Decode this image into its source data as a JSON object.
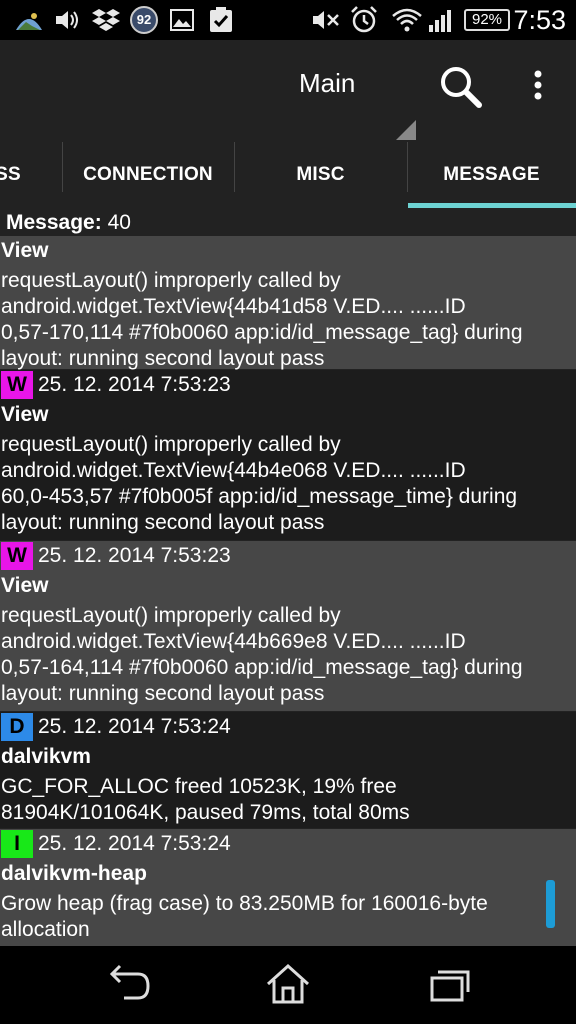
{
  "status_bar": {
    "time": "7:53",
    "battery": "92%",
    "notification_count": "92",
    "icons": [
      "weather-icon",
      "volume-icon",
      "dropbox-icon",
      "notification-count-icon",
      "image-icon",
      "clipboard-check-icon",
      "mute-icon",
      "alarm-icon",
      "wifi-icon",
      "signal-icon",
      "battery-icon"
    ]
  },
  "action_bar": {
    "spinner_label": "Main",
    "search_icon": "search-icon",
    "overflow_icon": "overflow-menu-icon"
  },
  "tabs": [
    {
      "label": "SS",
      "selected": false
    },
    {
      "label": "CONNECTION",
      "selected": false
    },
    {
      "label": "MISC",
      "selected": false
    },
    {
      "label": "MESSAGE",
      "selected": true
    }
  ],
  "message_count": {
    "label": "Message:",
    "value": "40"
  },
  "entries": [
    {
      "level": "",
      "timestamp": "",
      "tag": "View",
      "message": "requestLayout() improperly called by\nandroid.widget.TextView{44b41d58 V.ED.... ......ID\n0,57-170,114 #7f0b0060 app:id/id_message_tag} during\nlayout: running second layout pass"
    },
    {
      "level": "W",
      "timestamp": "25. 12. 2014 7:53:23",
      "tag": "View",
      "message": "requestLayout() improperly called by\nandroid.widget.TextView{44b4e068 V.ED.... ......ID\n60,0-453,57 #7f0b005f app:id/id_message_time} during\nlayout: running second layout pass"
    },
    {
      "level": "W",
      "timestamp": "25. 12. 2014 7:53:23",
      "tag": "View",
      "message": "requestLayout() improperly called by\nandroid.widget.TextView{44b669e8 V.ED.... ......ID\n0,57-164,114 #7f0b0060 app:id/id_message_tag} during\nlayout: running second layout pass"
    },
    {
      "level": "D",
      "timestamp": "25. 12. 2014 7:53:24",
      "tag": "dalvikvm",
      "message": "GC_FOR_ALLOC freed 10523K, 19% free\n81904K/101064K, paused 79ms, total 80ms"
    },
    {
      "level": "I",
      "timestamp": "25. 12. 2014 7:53:24",
      "tag": "dalvikvm-heap",
      "message": "Grow heap (frag case) to 83.250MB for 160016-byte\nallocation"
    }
  ],
  "nav_bar": {
    "icons": [
      "back-icon",
      "home-icon",
      "recent-apps-icon"
    ]
  },
  "colors": {
    "level_W": "#e815e8",
    "level_D": "#2d8ae8",
    "level_I": "#18e818",
    "tab_indicator": "#6dd3d3",
    "scroll_indicator": "#1d9cd6"
  }
}
